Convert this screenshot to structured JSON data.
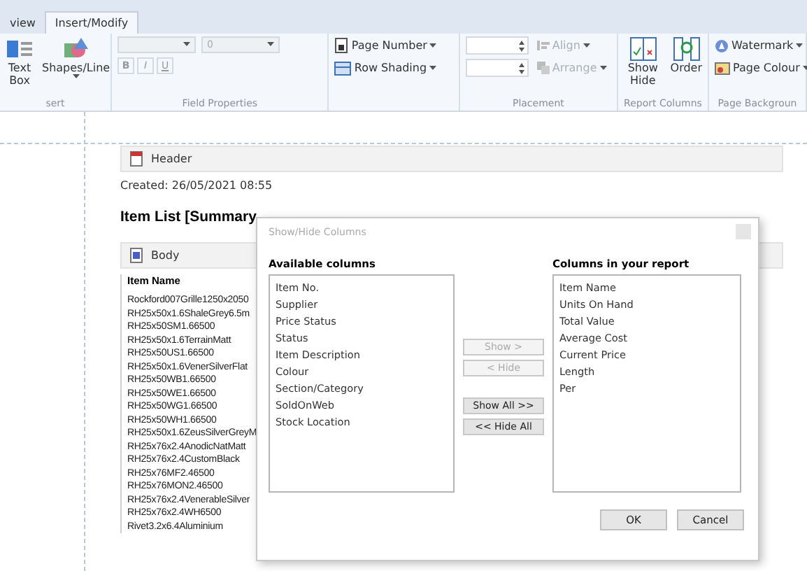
{
  "ribbon": {
    "tabs": [
      {
        "label": "view",
        "selected": false
      },
      {
        "label": "Insert/Modify",
        "selected": true
      }
    ],
    "groups": [
      {
        "label": "sert",
        "items": [
          {
            "kind": "large",
            "label": "Text Box",
            "dropdown": false
          },
          {
            "kind": "large",
            "label": "Shapes/Line",
            "dropdown": true
          }
        ]
      },
      {
        "label": "Field Properties",
        "kind": "font",
        "font_size": "0",
        "buttons": [
          "B",
          "I",
          "U"
        ]
      },
      {
        "items": [
          {
            "kind": "small",
            "label": "Page Number",
            "dropdown": true,
            "disabled": false
          },
          {
            "kind": "small",
            "label": "Row Shading",
            "dropdown": true,
            "disabled": false
          }
        ]
      },
      {
        "label": "Placement",
        "kind": "placement",
        "items": [
          {
            "kind": "small",
            "label": "Align",
            "dropdown": true,
            "disabled": true
          },
          {
            "kind": "small",
            "label": "Arrange",
            "dropdown": true,
            "disabled": true
          }
        ]
      },
      {
        "label": "Report Columns",
        "items": [
          {
            "kind": "large",
            "label": "Show Hide",
            "dropdown": false
          },
          {
            "kind": "large",
            "label": "Order",
            "dropdown": false
          }
        ]
      },
      {
        "label": "Page Backgroun",
        "items": [
          {
            "kind": "small",
            "label": "Watermark",
            "dropdown": true,
            "disabled": false
          },
          {
            "kind": "small",
            "label": "Page Colour",
            "dropdown": true,
            "disabled": false
          }
        ]
      }
    ]
  },
  "document": {
    "header_band": "Header",
    "created": "Created: 26/05/2021 08:55",
    "title": "Item List [Summary",
    "body_band": "Body",
    "column_header": "Item Name",
    "rows": [
      "Rockford007Grille1250x2050",
      "RH25x50x1.6ShaleGrey6.5m",
      "RH25x50SM1.66500",
      "RH25x50x1.6TerrainMatt",
      "RH25x50US1.66500",
      "RH25x50x1.6VenerSilverFlat",
      "RH25x50WB1.66500",
      "RH25x50WE1.66500",
      "RH25x50WG1.66500",
      "RH25x50WH1.66500",
      "RH25x50x1.6ZeusSilverGreyM",
      "RH25x76x2.4AnodicNatMatt",
      "RH25x76x2.4CustomBlack",
      "RH25x76MF2.46500",
      "RH25x76MON2.46500",
      "RH25x76x2.4VenerableSilver",
      "RH25x76x2.4WH6500",
      "Rivet3.2x6.4Aluminium"
    ]
  },
  "dialog": {
    "title": "Show/Hide Columns",
    "available_label": "Available columns",
    "available": [
      "Item No.",
      "Supplier",
      "Price Status",
      "Status",
      "Item Description",
      "Colour",
      "Section/Category",
      "SoldOnWeb",
      "Stock Location"
    ],
    "report_label": "Columns in your report",
    "report": [
      "Item Name",
      "Units On Hand",
      "Total Value",
      "Average Cost",
      "Current Price",
      "Length",
      "Per"
    ],
    "move_buttons": [
      {
        "label": "Show >",
        "disabled": true
      },
      {
        "label": "< Hide",
        "disabled": true
      },
      {
        "label": "Show All >>",
        "disabled": false
      },
      {
        "label": "<< Hide All",
        "disabled": false
      }
    ],
    "buttons": [
      "OK",
      "Cancel"
    ]
  }
}
